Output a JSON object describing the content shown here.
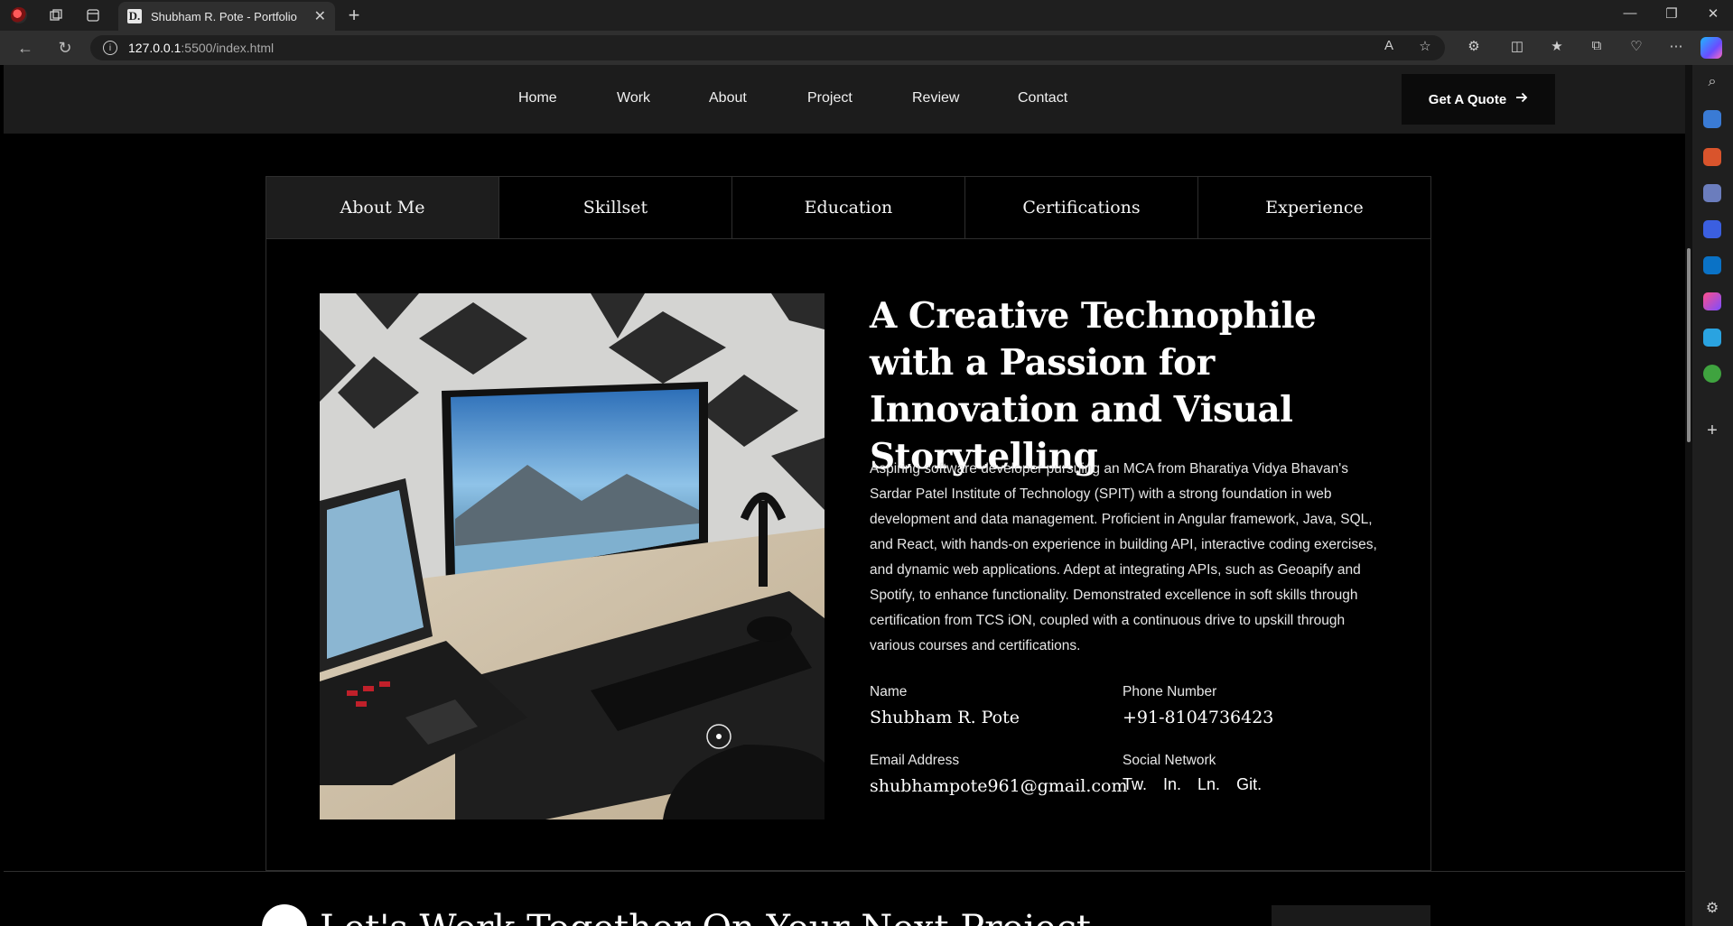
{
  "browser": {
    "tab_title": "Shubham R. Pote - Portfolio",
    "favicon_letter": "D.",
    "url_host": "127.0.0.1",
    "url_rest": ":5500/index.html"
  },
  "nav": {
    "items": [
      "Home",
      "Work",
      "About",
      "Project",
      "Review",
      "Contact"
    ],
    "cta_label": "Get A Quote"
  },
  "tabs": [
    "About Me",
    "Skillset",
    "Education",
    "Certifications",
    "Experience"
  ],
  "about": {
    "headline": "A Creative Technophile with a Passion for Innovation and Visual Storytelling",
    "bio": "Aspiring software developer pursuing an MCA from Bharatiya Vidya Bhavan's Sardar Patel Institute of Technology (SPIT) with a strong foundation in web development and data management. Proficient in Angular framework, Java, SQL, and React, with hands-on experience in building API, interactive coding exercises, and dynamic web applications. Adept at integrating APIs, such as Geoapify and Spotify, to enhance functionality. Demonstrated excellence in soft skills through certification from TCS iON, coupled with a continuous drive to upskill through various courses and certifications.",
    "name_label": "Name",
    "name_value": "Shubham R. Pote",
    "phone_label": "Phone Number",
    "phone_value": "+91-8104736423",
    "email_label": "Email Address",
    "email_value": "shubhampote961@gmail.com",
    "social_label": "Social Network",
    "social_links": [
      "Tw.",
      "In.",
      "Ln.",
      "Git."
    ]
  },
  "next_section": {
    "title": "Let's Work Together On Your Next Project"
  },
  "colors": {
    "page_bg": "#000000",
    "header_bg": "#1c1c1c",
    "active_tab_bg": "#1d1d1d",
    "border": "#2e2e2e"
  }
}
